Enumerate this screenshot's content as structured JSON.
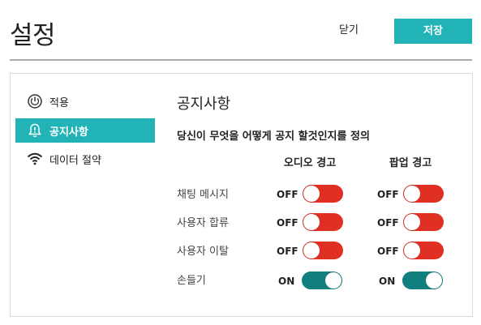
{
  "header": {
    "title": "설정",
    "close_label": "닫기",
    "save_label": "저장"
  },
  "sidebar": {
    "items": [
      {
        "label": "적용",
        "icon": "power-icon",
        "active": false
      },
      {
        "label": "공지사항",
        "icon": "bell-alert-icon",
        "active": true
      },
      {
        "label": "데이터 절약",
        "icon": "wifi-icon",
        "active": false
      }
    ]
  },
  "main": {
    "title": "공지사항",
    "description": "당신이 무엇을 어떻게 공지 할것인지를 정의",
    "columns": [
      "오디오 경고",
      "팝업 경고"
    ],
    "rows": [
      {
        "label": "채팅 메시지",
        "audio": "OFF",
        "popup": "OFF"
      },
      {
        "label": "사용자 합류",
        "audio": "OFF",
        "popup": "OFF"
      },
      {
        "label": "사용자 이탈",
        "audio": "OFF",
        "popup": "OFF"
      },
      {
        "label": "손들기",
        "audio": "ON",
        "popup": "ON"
      }
    ]
  },
  "colors": {
    "accent": "#22b3b7",
    "toggle_off": "#e03024",
    "toggle_on": "#117f7d"
  }
}
